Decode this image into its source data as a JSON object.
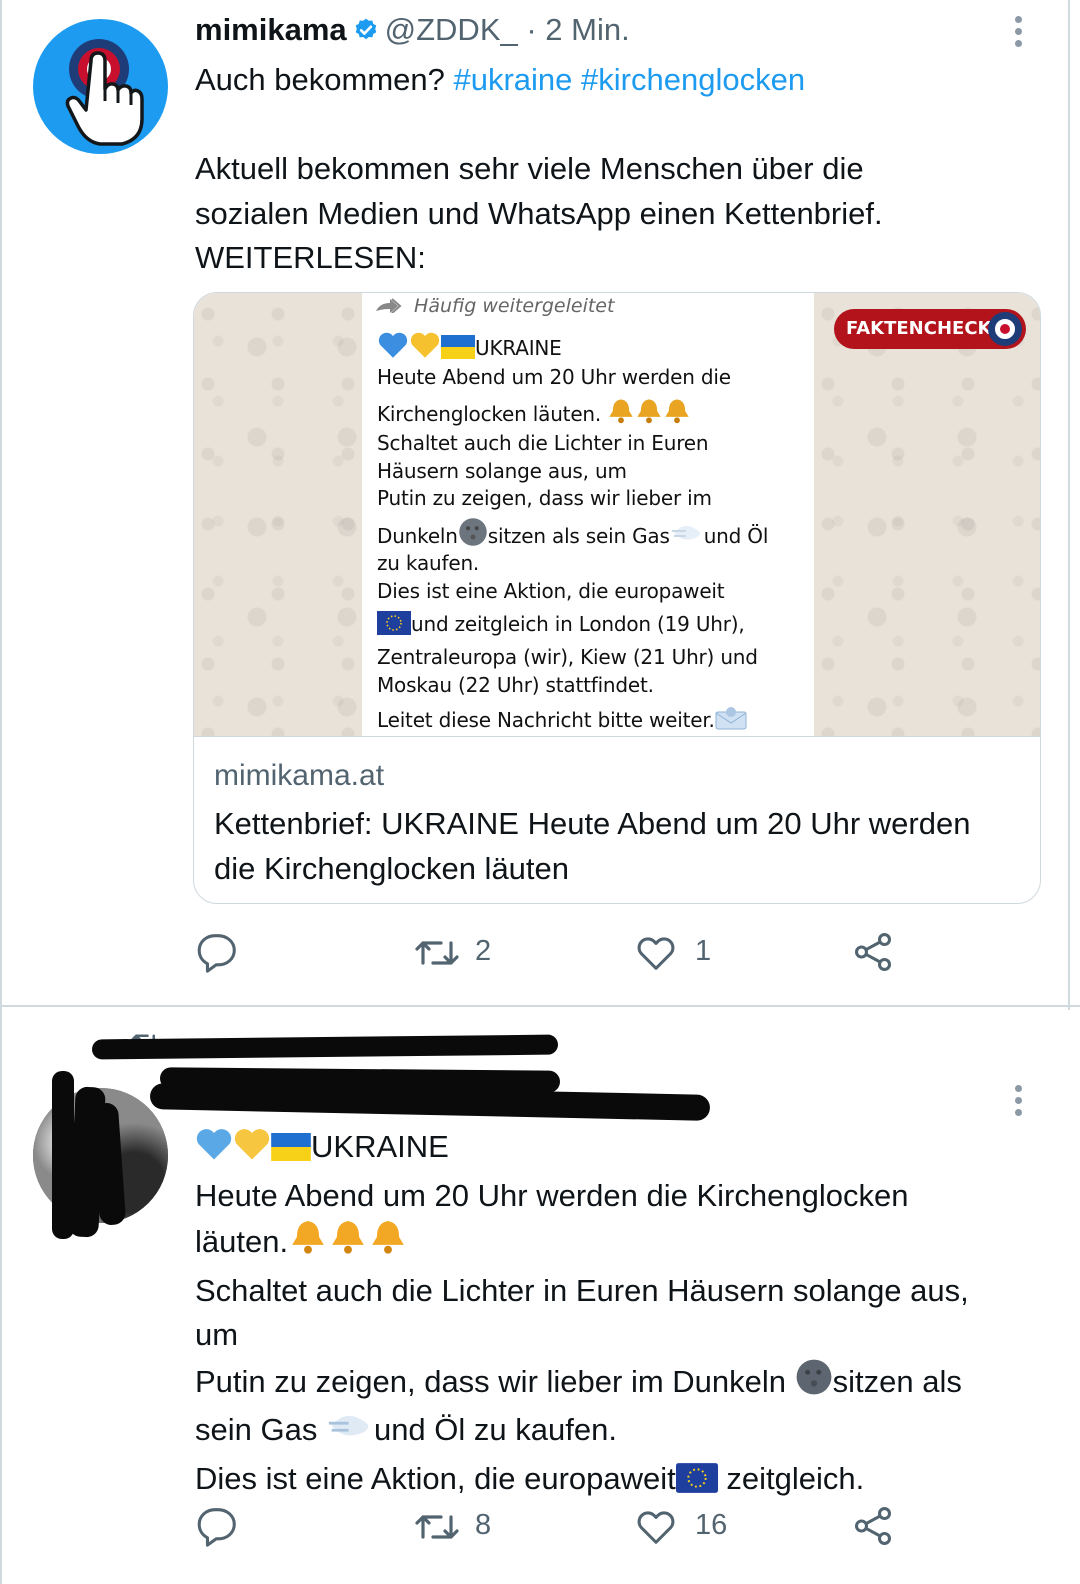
{
  "tweet1": {
    "author_name": "mimikama",
    "author_handle": "@ZDDK_",
    "time": "· 2 Min.",
    "text_lead": "Auch bekommen? ",
    "hashtags": [
      "#ukraine",
      "#kirchenglocken"
    ],
    "body_lines": [
      "Aktuell bekommen sehr viele Menschen über die",
      "sozialen Medien und WhatsApp einen Kettenbrief.",
      "WEITERLESEN:"
    ],
    "card": {
      "forward_label": "Häufig weitergeleitet",
      "badge": "FAKTENCHECK",
      "message_lines": [
        "UKRAINE",
        "Heute Abend um 20 Uhr werden die",
        "Kirchenglocken läuten.",
        "Schaltet auch die Lichter in Euren",
        "Häusern solange aus, um",
        "Putin zu zeigen, dass wir lieber im",
        "Dunkeln",
        "sitzen als sein Gas",
        "und Öl",
        "zu kaufen.",
        "Dies ist eine Aktion, die europaweit",
        "und zeitgleich in London (19 Uhr),",
        "Zentraleuropa (wir), Kiew (21 Uhr) und",
        "Moskau (22 Uhr) stattfindet.",
        "Leitet diese Nachricht bitte weiter."
      ],
      "domain": "mimikama.at",
      "title": "Kettenbrief: UKRAINE Heute Abend um 20 Uhr werden die Kirchenglocken läuten"
    },
    "actions": {
      "replies": "",
      "retweets": "2",
      "likes": "1"
    }
  },
  "tweet2": {
    "retweet_label": "",
    "text_lines": [
      "UKRAINE",
      "Heute Abend um 20 Uhr werden die Kirchenglocken",
      "läuten.",
      "Schaltet auch die Lichter in Euren Häusern solange aus,",
      "um",
      "Putin zu zeigen, dass wir lieber im Dunkeln ",
      "sitzen als",
      "sein Gas ",
      "und Öl zu kaufen.",
      "Dies ist eine Aktion, die europaweit",
      " zeitgleich."
    ],
    "actions": {
      "replies": "",
      "retweets": "8",
      "likes": "16"
    }
  },
  "icons": {
    "verified": "verified-badge-icon",
    "more": "more-options-icon",
    "reply": "reply-icon",
    "retweet": "retweet-icon",
    "like": "heart-icon",
    "share": "share-icon",
    "blue_heart": "blue-heart-emoji",
    "yellow_heart": "yellow-heart-emoji",
    "ukraine_flag": "ukraine-flag-emoji",
    "bell": "bell-emoji",
    "new_moon_face": "new-moon-face-emoji",
    "dash": "dash-emoji",
    "eu_flag": "eu-flag-emoji",
    "envelope": "envelope-emoji"
  },
  "colors": {
    "accent": "#1d9bf0",
    "text": "#0f1419",
    "secondary": "#536471",
    "badge_red": "#b3131b"
  }
}
